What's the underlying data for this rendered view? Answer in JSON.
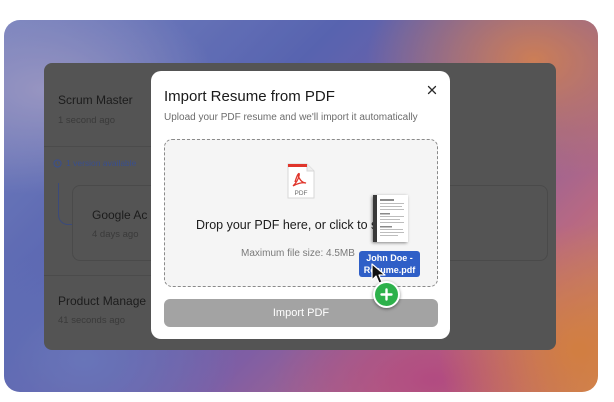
{
  "background": {
    "items": [
      {
        "title": "Scrum Master",
        "time": "1 second ago"
      },
      {
        "title": "Google Ac",
        "time": "4 days ago"
      },
      {
        "title": "Product Manage",
        "time": "41 seconds ago"
      }
    ],
    "version_label": "1 version available"
  },
  "modal": {
    "title": "Import Resume from PDF",
    "subtitle": "Upload your PDF resume and we'll import it automatically",
    "close_icon": "close-icon",
    "dropzone": {
      "icon": "pdf-file-icon",
      "icon_label": "PDF",
      "prompt": "Drop your PDF here, or click to s",
      "max_size": "Maximum file size: 4.5MB"
    },
    "import_button": "Import PDF"
  },
  "drag": {
    "file_label": "John Doe - Resume.pdf",
    "file_label_line1": "John Doe -",
    "file_label_line2": "Resume.pdf",
    "badge_icon": "plus-icon"
  },
  "colors": {
    "modal_bg": "#ffffff",
    "button_disabled": "#a3a3a3",
    "drag_label": "#2f5fc7",
    "badge_green": "#2db14b",
    "pdf_red": "#e0352b"
  }
}
